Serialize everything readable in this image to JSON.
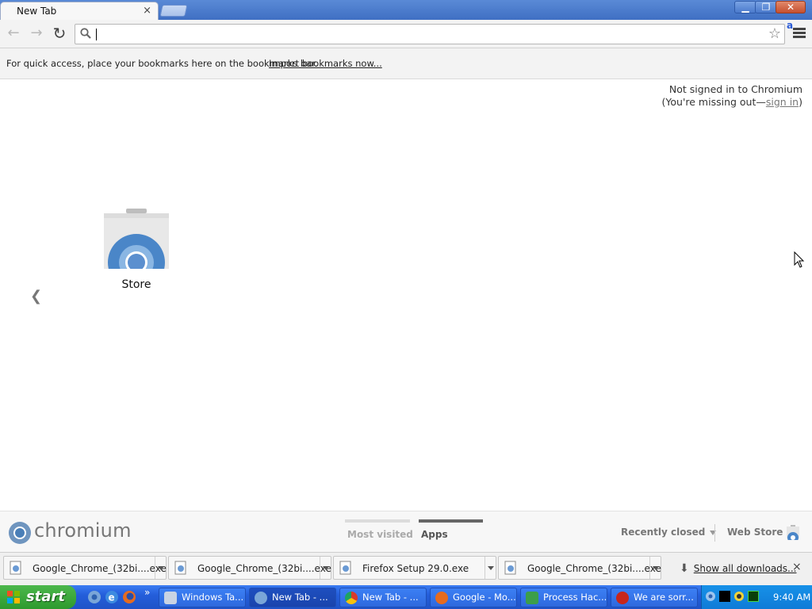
{
  "tab": {
    "title": "New Tab",
    "close_glyph": "×"
  },
  "window_controls": {
    "minimize": "▁",
    "restore": "❐",
    "close": "✕"
  },
  "toolbar": {
    "back_glyph": "←",
    "forward_glyph": "→",
    "reload_glyph": "↻",
    "omnibox_value": "",
    "star_glyph": "☆",
    "extension_letter": "a"
  },
  "bookmarks_bar": {
    "message": "For quick access, place your bookmarks here on the bookmarks bar.",
    "import_link": "Import bookmarks now..."
  },
  "signin": {
    "line1": "Not signed in to Chromium",
    "line2_prefix": "(You're missing out—",
    "link": "sign in",
    "line2_suffix": ")"
  },
  "apps": [
    {
      "label": "Store",
      "icon": "webstore-icon"
    }
  ],
  "pager": {
    "prev_glyph": "❮"
  },
  "ntp_footer": {
    "logo_text": "chromium",
    "tabs": [
      {
        "label": "Most visited",
        "selected": false
      },
      {
        "label": "Apps",
        "selected": true
      }
    ],
    "recently_closed": "Recently closed",
    "web_store": "Web Store"
  },
  "downloads": {
    "items": [
      {
        "name": "Google_Chrome_(32bi....exe",
        "icon": "installer-icon"
      },
      {
        "name": "Google_Chrome_(32bi....exe",
        "icon": "installer-icon"
      },
      {
        "name": "Firefox Setup 29.0.exe",
        "icon": "installer-icon"
      },
      {
        "name": "Google_Chrome_(32bi....exe",
        "icon": "installer-icon"
      }
    ],
    "show_all": "Show all downloads...",
    "close_glyph": "×"
  },
  "taskbar": {
    "start_label": "start",
    "quick_launch": [
      "chromium-icon",
      "ie-icon",
      "firefox-icon"
    ],
    "overflow": "»",
    "tasks": [
      {
        "label": "Windows Ta...",
        "icon": "task-manager-icon",
        "active": false
      },
      {
        "label": "New Tab - ...",
        "icon": "chromium-icon",
        "active": true
      },
      {
        "label": "New Tab - ...",
        "icon": "chrome-icon",
        "active": false
      },
      {
        "label": "Google - Mo...",
        "icon": "firefox-icon",
        "active": false
      },
      {
        "label": "Process Hac...",
        "icon": "process-hacker-icon",
        "active": false
      },
      {
        "label": "We are sorr...",
        "icon": "error-icon",
        "active": false
      }
    ],
    "clock": "9:40 AM"
  },
  "colors": {
    "taskbar_blue": "#245edb",
    "start_green": "#2e9a2e",
    "tray_blue": "#0f7bd7",
    "tabstrip_blue": "#4a7bd0"
  }
}
